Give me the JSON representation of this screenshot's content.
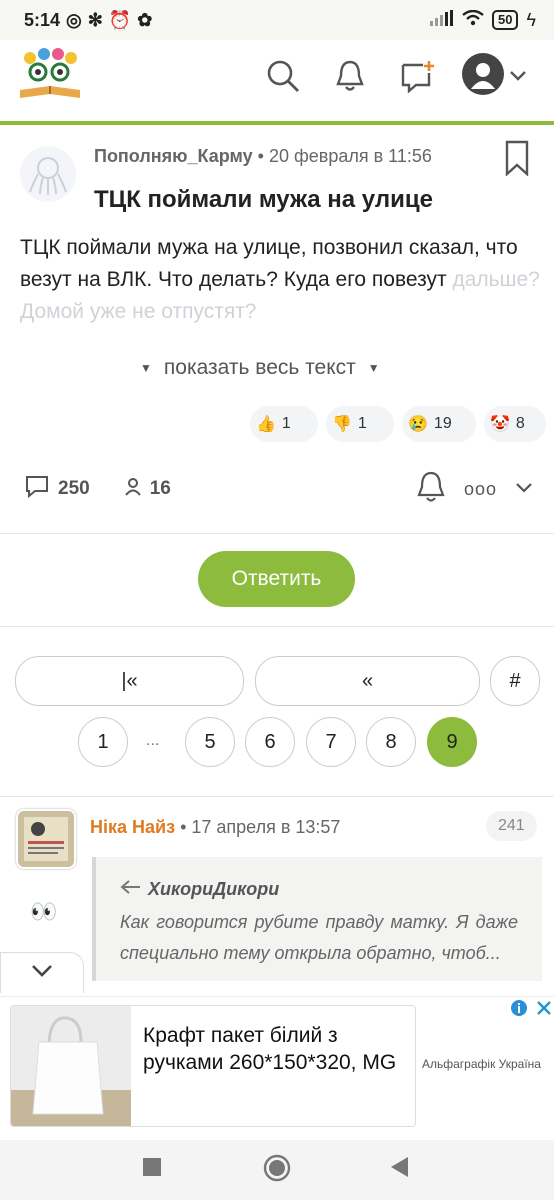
{
  "status_bar": {
    "time": "5:14",
    "battery": "50"
  },
  "post": {
    "author": "Пополняю_Карму",
    "date": "20 февраля в 11:56",
    "title": "ТЦК поймали мужа на улице",
    "body_visible": "ТЦК поймали мужа на улице, позвонил сказал, что везут на ВЛК. Что делать? Куда его повезут",
    "body_faded": "дальше? Домой уже не отпустят?",
    "show_more_label": "показать весь текст",
    "reactions": [
      {
        "icon": "thumbs-up",
        "count": "1"
      },
      {
        "icon": "thumbs-down",
        "count": "1"
      },
      {
        "icon": "crying-face",
        "count": "19"
      },
      {
        "icon": "clown-face",
        "count": "8"
      }
    ],
    "comments_count": "250",
    "participants_count": "16"
  },
  "reply_button_label": "Ответить",
  "pagination": {
    "first_label": "|«",
    "prev_label": "«",
    "hash_label": "#",
    "pages": [
      "1",
      "5",
      "6",
      "7",
      "8",
      "9"
    ],
    "ellipsis": "...",
    "current_page": "9"
  },
  "comment": {
    "author": "Ніка Найз",
    "date": "17 апреля в 13:57",
    "number": "241",
    "quote_author": "ХикориДикори",
    "quote_text": "Как говорится рубите правду матку. Я даже специально тему открыла обратно, чтоб..."
  },
  "ad": {
    "title": "Крафт пакет білий з ручками 260*150*320, MG",
    "brand": "Альфаграфік Україна"
  },
  "colors": {
    "accent": "#8cbb3d",
    "author_orange": "#e07b20"
  }
}
